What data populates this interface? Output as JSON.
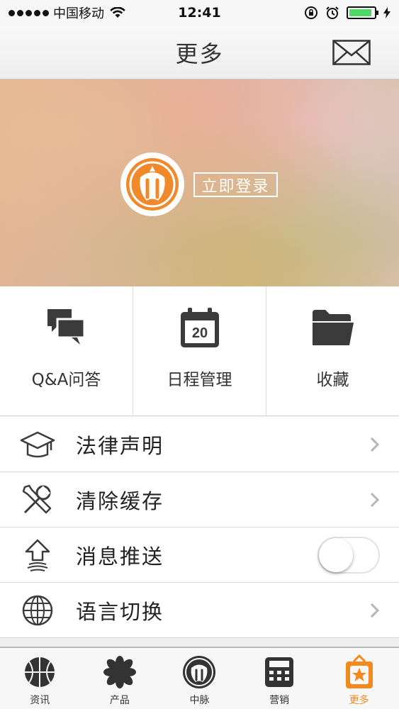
{
  "status_bar": {
    "carrier": "中国移动",
    "time": "12:41",
    "battery_level": 0.9
  },
  "nav": {
    "title": "更多",
    "mail_icon": "envelope-icon"
  },
  "banner": {
    "login_label": "立即登录",
    "logo_icon": "brand-logo"
  },
  "grid": [
    {
      "label": "Q&A问答",
      "icon": "chat-bubbles-icon"
    },
    {
      "label": "日程管理",
      "icon": "calendar-icon",
      "badge": "20"
    },
    {
      "label": "收藏",
      "icon": "folder-icon"
    }
  ],
  "list": [
    {
      "label": "法律声明",
      "icon": "graduation-cap-icon"
    },
    {
      "label": "清除缓存",
      "icon": "tools-icon"
    },
    {
      "label": "消息推送",
      "icon": "push-arrow-icon",
      "toggle": false
    },
    {
      "label": "语言切换",
      "icon": "globe-icon"
    }
  ],
  "tabs": [
    {
      "label": "资讯",
      "icon": "basketball-icon"
    },
    {
      "label": "产品",
      "icon": "asterisk-icon"
    },
    {
      "label": "中脉",
      "icon": "brand-logo-icon"
    },
    {
      "label": "营销",
      "icon": "calculator-icon"
    },
    {
      "label": "更多",
      "icon": "star-bag-icon",
      "active": true
    }
  ],
  "colors": {
    "accent": "#f28a1f",
    "toggle_off": "#ffffff",
    "battery": "#4cd964"
  }
}
